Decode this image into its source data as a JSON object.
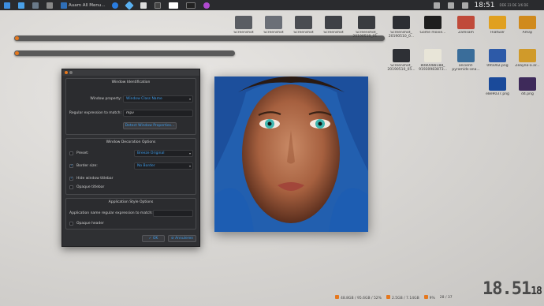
{
  "taskbar": {
    "window_title": "Auam All Menu...",
    "clock": "18:51",
    "date_small": "DDE 23 DE\n3/6 DE"
  },
  "desktop_icons": [
    {
      "label": "Screenshot",
      "color": "#5a5d63"
    },
    {
      "label": "Screenshot",
      "color": "#6b6f77"
    },
    {
      "label": "Screenshot",
      "color": "#4a4c51"
    },
    {
      "label": "Screenshot",
      "color": "#3f4146"
    },
    {
      "label": "Screenshot_ 20190510_01...",
      "color": "#3a3c40"
    },
    {
      "label": "Screenshot_ 20190510_0...",
      "color": "#2c2e33"
    },
    {
      "label": "Gome movie...",
      "color": "#1e1e1e"
    },
    {
      "label": "Zamsam",
      "color": "#c04a3a"
    },
    {
      "label": "HiatSolr",
      "color": "#e0a020"
    },
    {
      "label": "Amaji",
      "color": "#d08a1c"
    },
    {
      "label": "Screenshot_ 20190510_05...",
      "color": "#2e3035"
    },
    {
      "label": "8080088188_ 91930983873...",
      "color": "#e8e5d8"
    },
    {
      "label": "ancient- pyramids-ana...",
      "color": "#3a6d9a"
    },
    {
      "label": "095002.png",
      "color": "#2d5aa8"
    },
    {
      "label": "Zeayna-a.ar...",
      "color": "#d09a2a"
    },
    {
      "label": "e8e9037.png",
      "color": "#1a4a9a"
    },
    {
      "label": "d4.png",
      "color": "#3e2a5a"
    }
  ],
  "dialog": {
    "window_identification_title": "Window Identification",
    "window_property_label": "Window property:",
    "window_property_value": "Window Class Name",
    "regex_label": "Regular expression to match:",
    "regex_value": "mpv",
    "detect_button": "Detect Window Properties...",
    "decoration_title": "Window Decoration Options",
    "preset_label": "Preset:",
    "preset_value": "Breeze Original",
    "border_size_label": "Border size:",
    "border_size_value": "No Border",
    "hide_titlebar_label": "Hide window titlebar",
    "opaque_titlebar_label": "Opaque titlebar",
    "app_style_title": "Application Style Options",
    "app_regex_label": "Application name regular expression to match:",
    "opaque_header_label": "Opaque header",
    "ok_button": "OK",
    "cancel_button": "Annuleren"
  },
  "status": {
    "stat1": "48.8GB / 95.6GB / 52%",
    "stat2": "2.5GB / 7.14GB",
    "stat3": "9%",
    "stat4": "28 / 37",
    "big_time": "18.51",
    "big_seconds": "18"
  },
  "colors": {
    "accent": "#e5781e",
    "link_blue": "#3d9be9"
  }
}
